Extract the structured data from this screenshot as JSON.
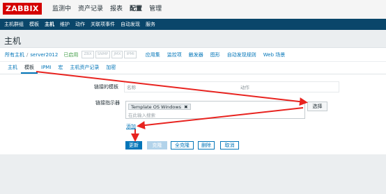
{
  "app": {
    "logo": "ZABBIX"
  },
  "top_menu": [
    "监测中",
    "资产记录",
    "报表",
    "配置",
    "管理"
  ],
  "top_menu_active": "配置",
  "sub_menu": [
    "主机群组",
    "模板",
    "主机",
    "维护",
    "动作",
    "关联项事件",
    "自动发现",
    "服务"
  ],
  "sub_menu_active": "主机",
  "page_title": "主机",
  "breadcrumb": {
    "all_hosts": "所有主机",
    "separator": "/",
    "host": "server2012",
    "status": "已启用"
  },
  "availability_badges": [
    "ZBX",
    "SNMP",
    "JMX",
    "IPMI"
  ],
  "host_links": [
    "应用集",
    "监控项",
    "触发器",
    "图形",
    "自动发现规则",
    "Web 场景"
  ],
  "tabs": [
    "主机",
    "模板",
    "IPMI",
    "宏",
    "主机资产记录",
    "加密"
  ],
  "tabs_active": "模板",
  "form": {
    "linked_templates_label": "链接的模板",
    "col_name": "名称",
    "col_action": "动作",
    "link_indicator_label": "链接指示器",
    "selected_template": "Template OS Windows",
    "remove_glyph": "✖",
    "search_placeholder": "在此输入搜索",
    "select_button": "选择",
    "add_link": "添加"
  },
  "actions": {
    "update": "更新",
    "clone": "克隆",
    "full_clone": "全克隆",
    "delete": "删除",
    "cancel": "取消"
  },
  "colors": {
    "brand_red": "#d40000",
    "nav_blue": "#0a466a",
    "link_blue": "#0275b8",
    "annotation_red": "#e8231f"
  }
}
